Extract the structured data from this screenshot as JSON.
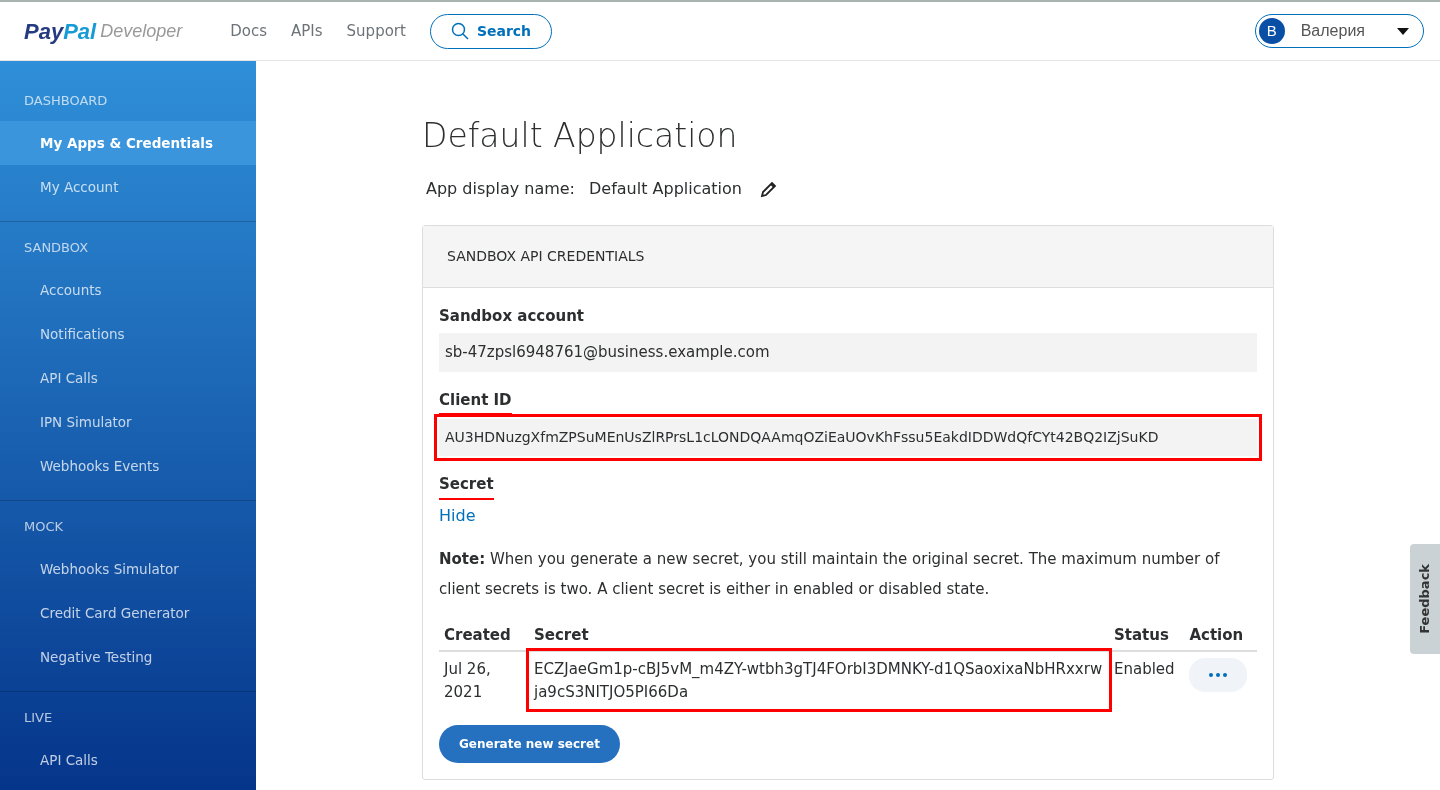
{
  "header": {
    "logo_parts": [
      "Pay",
      "Pal"
    ],
    "logo_suffix": "Developer",
    "nav": [
      "Docs",
      "APIs",
      "Support"
    ],
    "search": "Search",
    "user": {
      "initial": "B",
      "name": "Валерия"
    }
  },
  "sidebar": [
    {
      "heading": "DASHBOARD",
      "items": [
        {
          "label": "My Apps & Credentials",
          "selected": true
        },
        {
          "label": "My Account",
          "selected": false
        }
      ]
    },
    {
      "heading": "SANDBOX",
      "items": [
        {
          "label": "Accounts",
          "selected": false
        },
        {
          "label": "Notifications",
          "selected": false
        },
        {
          "label": "API Calls",
          "selected": false
        },
        {
          "label": "IPN Simulator",
          "selected": false
        },
        {
          "label": "Webhooks Events",
          "selected": false
        }
      ]
    },
    {
      "heading": "MOCK",
      "items": [
        {
          "label": "Webhooks Simulator",
          "selected": false
        },
        {
          "label": "Credit Card Generator",
          "selected": false
        },
        {
          "label": "Negative Testing",
          "selected": false
        }
      ]
    },
    {
      "heading": "LIVE",
      "items": [
        {
          "label": "API Calls",
          "selected": false
        }
      ]
    }
  ],
  "page": {
    "title": "Default Application",
    "display_name_label": "App display name:",
    "display_name": "Default Application"
  },
  "card": {
    "header": "SANDBOX API CREDENTIALS",
    "fields": [
      {
        "label": "Sandbox account",
        "value": "sb-47zpsl6948761@business.example.com",
        "annotated": false
      },
      {
        "label": "Client ID",
        "value": "AU3HDNuzgXfmZPSuMEnUsZlRPrsL1cLONDQAAmqOZiEaUOvKhFssu5EakdIDDWdQfCYt42BQ2IZjSuKD",
        "annotated": true
      }
    ],
    "secret_label": "Secret",
    "secret_annotated": true,
    "hide_link": "Hide",
    "note": "**Note:** When you generate a new secret, you still maintain the original secret. The maximum number of client secrets is two. A client secret is either in enabled or disabled state.",
    "table": {
      "columns": [
        "Created",
        "Secret",
        "Status",
        "Action"
      ],
      "rows": [
        {
          "created": "Jul 26, 2021",
          "secret": "ECZJaeGm1p-cBJ5vM_m4ZY-wtbh3gTJ4FOrbI3DMNKY-d1QSaoxixaNbHRxxrwja9cS3NITJO5PI66Da",
          "status": "Enabled",
          "annotated": true
        }
      ]
    },
    "generate_button": "Generate new secret"
  },
  "feedback": "Feedback"
}
